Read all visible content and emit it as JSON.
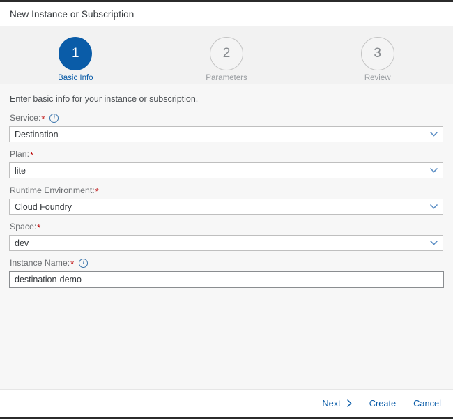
{
  "window": {
    "title": "New Instance or Subscription"
  },
  "wizard": {
    "steps": [
      {
        "number": "1",
        "label": "Basic Info",
        "state": "active"
      },
      {
        "number": "2",
        "label": "Parameters",
        "state": "inactive"
      },
      {
        "number": "3",
        "label": "Review",
        "state": "inactive"
      }
    ]
  },
  "form": {
    "intro": "Enter basic info for your instance or subscription.",
    "fields": [
      {
        "label": "Service:",
        "required": "*",
        "has_info": true,
        "type": "select",
        "value": "Destination"
      },
      {
        "label": "Plan:",
        "required": "*",
        "has_info": false,
        "type": "select",
        "value": "lite"
      },
      {
        "label": "Runtime Environment:",
        "required": "*",
        "has_info": false,
        "type": "select",
        "value": "Cloud Foundry"
      },
      {
        "label": "Space:",
        "required": "*",
        "has_info": false,
        "type": "select",
        "value": "dev"
      },
      {
        "label": "Instance Name:",
        "required": "*",
        "has_info": true,
        "type": "text",
        "value": "destination-demo"
      }
    ]
  },
  "footer": {
    "next_label": "Next",
    "create_label": "Create",
    "cancel_label": "Cancel"
  },
  "colors": {
    "accent": "#0a5ca8",
    "required": "#bb0000",
    "inactive_step": "#9a9ea2",
    "band_bg": "#f2f2f2",
    "body_bg": "#f7f7f7"
  },
  "icons": {
    "info": "i",
    "chevron_down": "chevron-down-icon",
    "chevron_right": "chevron-right-icon"
  }
}
